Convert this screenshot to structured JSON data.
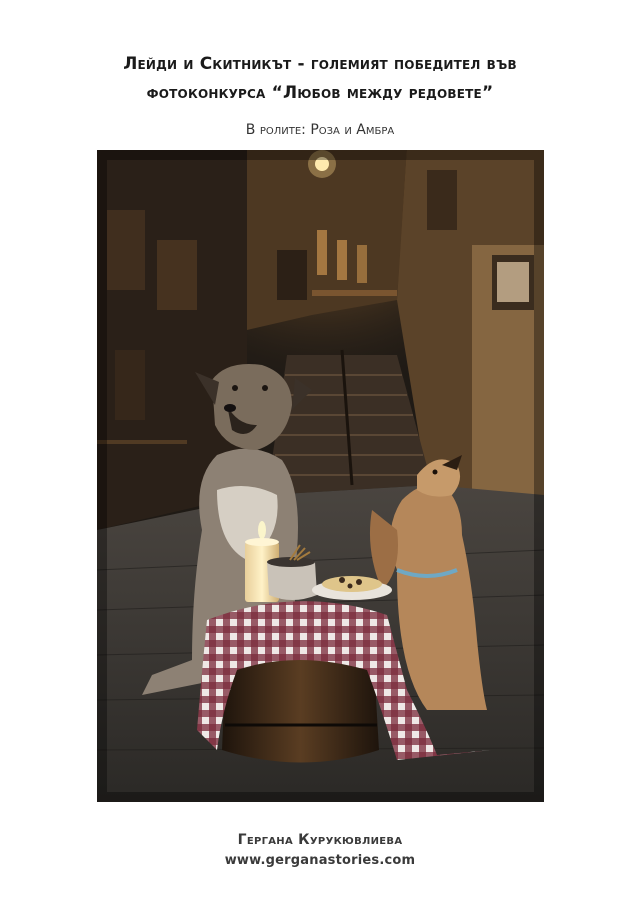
{
  "header": {
    "title_line1": "Лейди и Скитникът - големият победител във",
    "title_line2": "фотоконкурса “Любов между редовете”",
    "subtitle": "В ролите: Роза и Амбра"
  },
  "photo": {
    "subject": "two-dogs-spaghetti-dinner-alley"
  },
  "footer": {
    "author": "Гергана Курукювлиева",
    "website": "www.gerganastories.com"
  }
}
